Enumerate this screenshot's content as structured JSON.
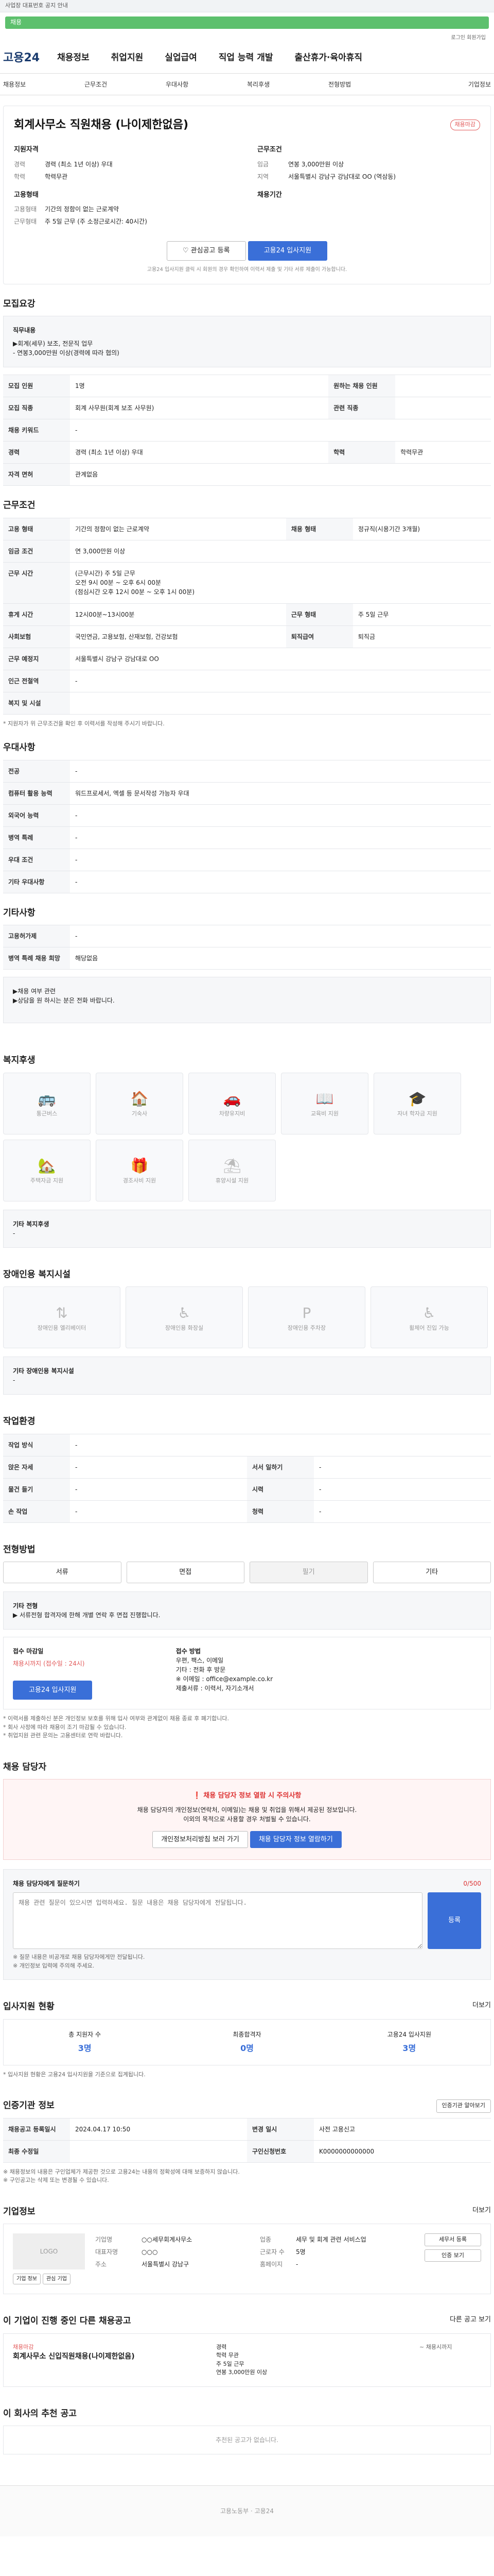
{
  "top": {
    "notice": "사업장 대표번호 공지 안내",
    "banner": "채용"
  },
  "util": "로그인  회원가입",
  "logo": "고용24",
  "gnb": [
    "채용정보",
    "취업지원",
    "실업급여",
    "직업 능력 개발",
    "출산휴가·육아휴직"
  ],
  "breadcrumb": {
    "left": "채용정보",
    "path": [
      "근무조건",
      "우대사항",
      "복리후생",
      "전형방법",
      "기업정보"
    ]
  },
  "job": {
    "company": "",
    "title": "회계사무소 직원채용 (나이제한없음)",
    "tag": "채용마감",
    "left_head": "지원자격",
    "left": [
      [
        "경력",
        "경력 (최소 1년 이상) 우대"
      ],
      [
        "학력",
        "학력무관"
      ]
    ],
    "left_head2": "고용형태",
    "left2": [
      [
        "고용형태",
        "기간의 정함이 없는 근로계약"
      ],
      [
        "근무형태",
        "주 5일 근무 (주 소정근로시간: 40시간)"
      ]
    ],
    "right_head": "근무조건",
    "right": [
      [
        "임금",
        "연봉 3,000만원 이상"
      ],
      [
        "지역",
        "서울특별시 강남구 강남대로 OO (역삼동)"
      ]
    ],
    "right_head2": "채용기간",
    "save_btn": "관심공고 등록",
    "apply_btn": "고용24 입사지원",
    "apply_note": "고용24 입사지원 클릭 시 회원의 경우 확인하여 이력서 제출 및 기타 서류 제출이 가능합니다."
  },
  "s_duty": {
    "title": "모집요강",
    "head": "직무내용",
    "lines": [
      "▶회계(세무) 보조, 전문직 업무",
      "- 연봉3,000만원 이상(경력에 따라 협의)"
    ]
  },
  "duty_rows": [
    [
      "모집 인원",
      "1명",
      "원하는 채용 인원",
      ""
    ],
    [
      "모집 직종",
      "회계 사무원(회계 보조 사무원)",
      "관련 직종",
      ""
    ],
    [
      "채용 키워드",
      "-",
      "",
      ""
    ],
    [
      "경력",
      "경력 (최소 1년 이상) 우대",
      "학력",
      "학력무관"
    ],
    [
      "자격 면허",
      "관계없음",
      "",
      ""
    ]
  ],
  "s_cond": {
    "title": "근무조건"
  },
  "cond_rows": [
    [
      "고용 형태",
      "기간의 정함이 없는 근로계약",
      "채용 형태",
      "정규직(시용기간 3개월)"
    ],
    [
      "임금 조건",
      "연 3,000만원 이상",
      "",
      ""
    ],
    [
      "근무 시간",
      "(근무시간) 주 5일 근무\n오전 9시 00분 ~ 오후 6시 00분\n(점심시간 오후 12시 00분 ~ 오후 1시 00분)",
      "",
      ""
    ],
    [
      "휴게 시간",
      "12시00분~13시00분",
      "근무 형태",
      "주 5일 근무"
    ],
    [
      "사회보험",
      "국민연금, 고용보험, 산재보험, 건강보험",
      "퇴직급여",
      "퇴직금"
    ],
    [
      "근무 예정지",
      "서울특별시 강남구 강남대로 OO",
      "",
      ""
    ],
    [
      "인근 전철역",
      "-",
      "",
      ""
    ],
    [
      "복지 및 시설",
      "",
      "",
      ""
    ]
  ],
  "cond_note": "* 지원자가 위 근무조건을 확인 후 이력서를 작성해 주시기 바랍니다.",
  "s_pref": {
    "title": "우대사항"
  },
  "pref_rows": [
    [
      "전공",
      "-"
    ],
    [
      "컴퓨터 활용 능력",
      "워드프로세서, 엑셀 등 문서작성 가능자 우대"
    ],
    [
      "외국어 능력",
      "-"
    ],
    [
      "병역 특례",
      "-"
    ],
    [
      "우대 조건",
      "-"
    ],
    [
      "기타 우대사항",
      "-"
    ]
  ],
  "s_etc": {
    "title": "기타사항"
  },
  "etc_rows": [
    [
      "고용허가제",
      "-"
    ],
    [
      "병역 특례 채용 희망",
      "해당없음"
    ]
  ],
  "etc_box": [
    "▶채용 여부 관련",
    "▶상담을 원 하시는 분은 전화 바랍니다."
  ],
  "s_welfare": {
    "title": "복지후생"
  },
  "welfare_tiles": [
    "통근버스",
    "기숙사",
    "차량유지비",
    "교육비 지원",
    "자녀 학자금 지원",
    "주택자금 지원",
    "경조사비 지원",
    "휴양시설 지원"
  ],
  "welfare_box_title": "기타 복지후생",
  "welfare_box_val": "-",
  "s_disabled": {
    "title": "장애인용 복지시설"
  },
  "disabled_tiles": [
    "장애인용 엘리베이터",
    "장애인용 화장실",
    "장애인용 주차장",
    "휠체어 진입 가능"
  ],
  "disabled_box_title": "기타 장애인용 복지시설",
  "disabled_box_val": "-",
  "s_work": {
    "title": "작업환경"
  },
  "work_rows": [
    [
      "작업 방식",
      "-",
      "",
      ""
    ],
    [
      "앉은 자세",
      "-",
      "서서 일하기",
      "-"
    ],
    [
      "물건 들기",
      "-",
      "시력",
      "-"
    ],
    [
      "손 작업",
      "-",
      "청력",
      "-"
    ]
  ],
  "s_method": {
    "title": "전형방법"
  },
  "method_btns": [
    "서류",
    "면접",
    "필기",
    "기타"
  ],
  "method_box_title": "기타 전형",
  "method_box_val": "▶ 서류전형 합격자에 한해 개별 연락 후 면접 진행합니다.",
  "apply_box": {
    "left_title": "접수 마감일",
    "left_val": "채용시까지 (접수일 : 24시)",
    "apply_btn": "고용24 입사지원",
    "right_title": "접수 방법",
    "right_lines": [
      "우편, 팩스, 이메일",
      "기타 : 전화 후 방문",
      "※ 이메일 : office@example.co.kr",
      "제출서류 : 이력서, 자기소개서"
    ]
  },
  "method_notes": [
    "* 이력서를 제출하신 분은 개인정보 보호를 위해 입사 여부와 관계없이 채용 종료 후 폐기합니다.",
    "* 회사 사정에 따라 채용이 조기 마감될 수 있습니다.",
    "* 취업지원 관련 문의는 고용센터로 연락 바랍니다."
  ],
  "s_recruiter": {
    "title": "채용 담당자"
  },
  "recruit_alert": {
    "title": "❗ 채용 담당자 정보 열람 시 주의사항",
    "lines": [
      "채용 담당자의 개인정보(연락처, 이메일)는 채용 및 취업을 위해서 제공된 정보입니다.",
      "이외의 목적으로 사용할 경우 처벌될 수 있습니다."
    ],
    "btn1": "개인정보처리방침 보러 가기",
    "btn2": "채용 담당자 정보 열람하기"
  },
  "qna": {
    "title": "채용 담당자에게 질문하기",
    "counter": "0/500",
    "placeholder": "채용 관련 질문이 있으시면 입력하세요. 질문 내용은 채용 담당자에게 전달됩니다.",
    "btn": "등록",
    "notes": [
      "※ 질문 내용은 비공개로 채용 담당자에게만 전달됩니다.",
      "※ 개인정보 입력에 주의해 주세요."
    ]
  },
  "s_status": {
    "title": "입사지원 현황",
    "more": "더보기"
  },
  "stats": [
    [
      "총 지원자 수",
      "3명"
    ],
    [
      "최종합격자",
      "0명"
    ],
    [
      "고용24 입사지원",
      "3명"
    ]
  ],
  "stats_note": "* 입사지원 현황은 고용24 입사지원을 기준으로 집계됩니다.",
  "s_info": {
    "title": "인증기관 정보",
    "btn": "인증기관 알아보기"
  },
  "info_rows": [
    [
      "채용공고 등록일시",
      "2024.04.17 10:50",
      "변경 일시",
      "사전 고용신고"
    ],
    [
      "최종 수정일",
      "",
      "구인신청번호",
      "K0000000000000"
    ]
  ],
  "info_notes": [
    "※ 채용정보의 내용은 구인업체가 제공한 것으로 고용24는 내용의 정확성에 대해 보증하지 않습니다.",
    "※ 구인공고는 삭제 또는 변경될 수 있습니다."
  ],
  "s_company": {
    "title": "기업정보",
    "more": "더보기"
  },
  "company": {
    "logo": "LOGO",
    "name": "회계사무소",
    "btn1": "기업 정보",
    "btn2": "관심 기업",
    "rows": [
      [
        "기업명",
        "○○세무회계사무소",
        "업종",
        "세무 및 회계 관련 서비스업"
      ],
      [
        "대표자명",
        "○○○",
        "근로자 수",
        "5명"
      ],
      [
        "주소",
        "서울특별시 강남구",
        "홈페이지",
        "-"
      ]
    ],
    "side": [
      "세무서 등록",
      "인증 보기"
    ]
  },
  "s_similar": {
    "title": "이 기업이 진행 중인 다른 채용공고",
    "more": "다른 공고 보기"
  },
  "similar": {
    "tag": "채용마감",
    "title": "회계사무소 신입직원채용(나이제한없음)",
    "lines": [
      "경력",
      "학력 무관",
      "주 5일 근무",
      "연봉 3,000만원 이상"
    ],
    "date": "~ 채용시까지"
  },
  "s_recommend": {
    "title": "이 회사의 추천 공고"
  },
  "recommend_empty": "추천된 공고가 없습니다.",
  "footer": "고용노동부 · 고용24"
}
